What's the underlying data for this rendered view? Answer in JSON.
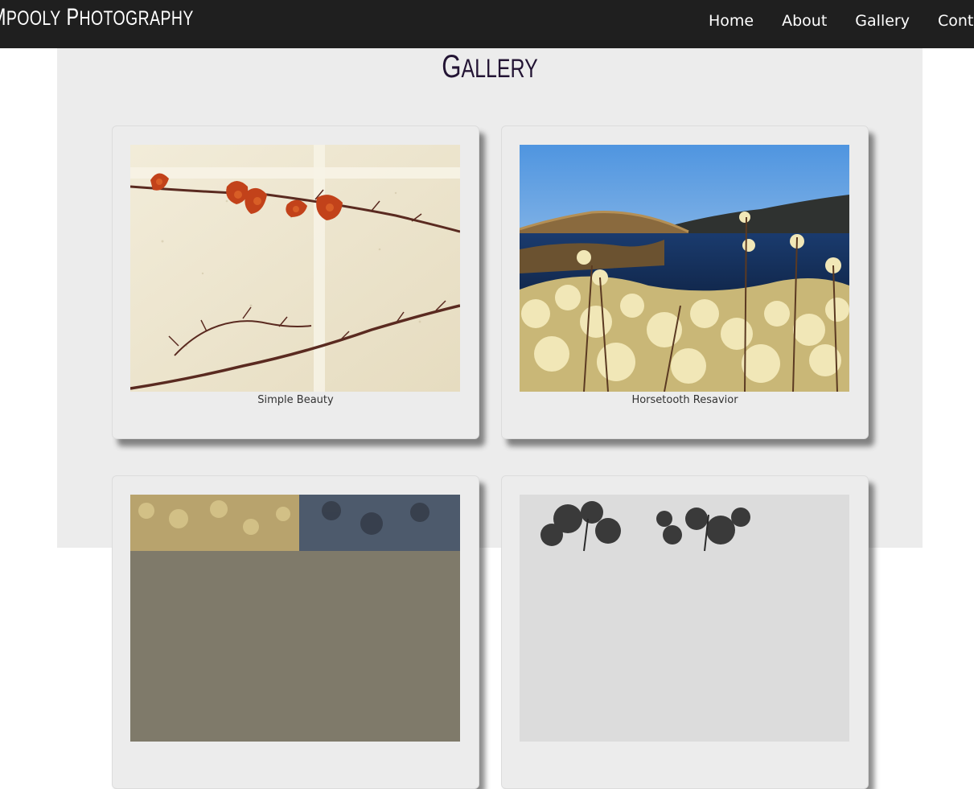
{
  "brand": {
    "first_big": "M",
    "first_small": "P",
    "leading_clipped": "P",
    "tail": "OOLY",
    "second_big": "P",
    "second_small": "HOTOGRAPHY"
  },
  "nav": {
    "items": [
      {
        "label": "Home"
      },
      {
        "label": "About"
      },
      {
        "label": "Gallery"
      },
      {
        "label": "Contact"
      }
    ]
  },
  "page": {
    "title_big": "G",
    "title_small": "ALLERY"
  },
  "gallery": {
    "cards": [
      {
        "caption": "Simple Beauty"
      },
      {
        "caption": "Horsetooth Resavior"
      },
      {
        "caption": ""
      },
      {
        "caption": ""
      }
    ]
  },
  "colors": {
    "navbar": "#1f1f1f",
    "content_bg": "#ececec",
    "title": "#231434"
  }
}
